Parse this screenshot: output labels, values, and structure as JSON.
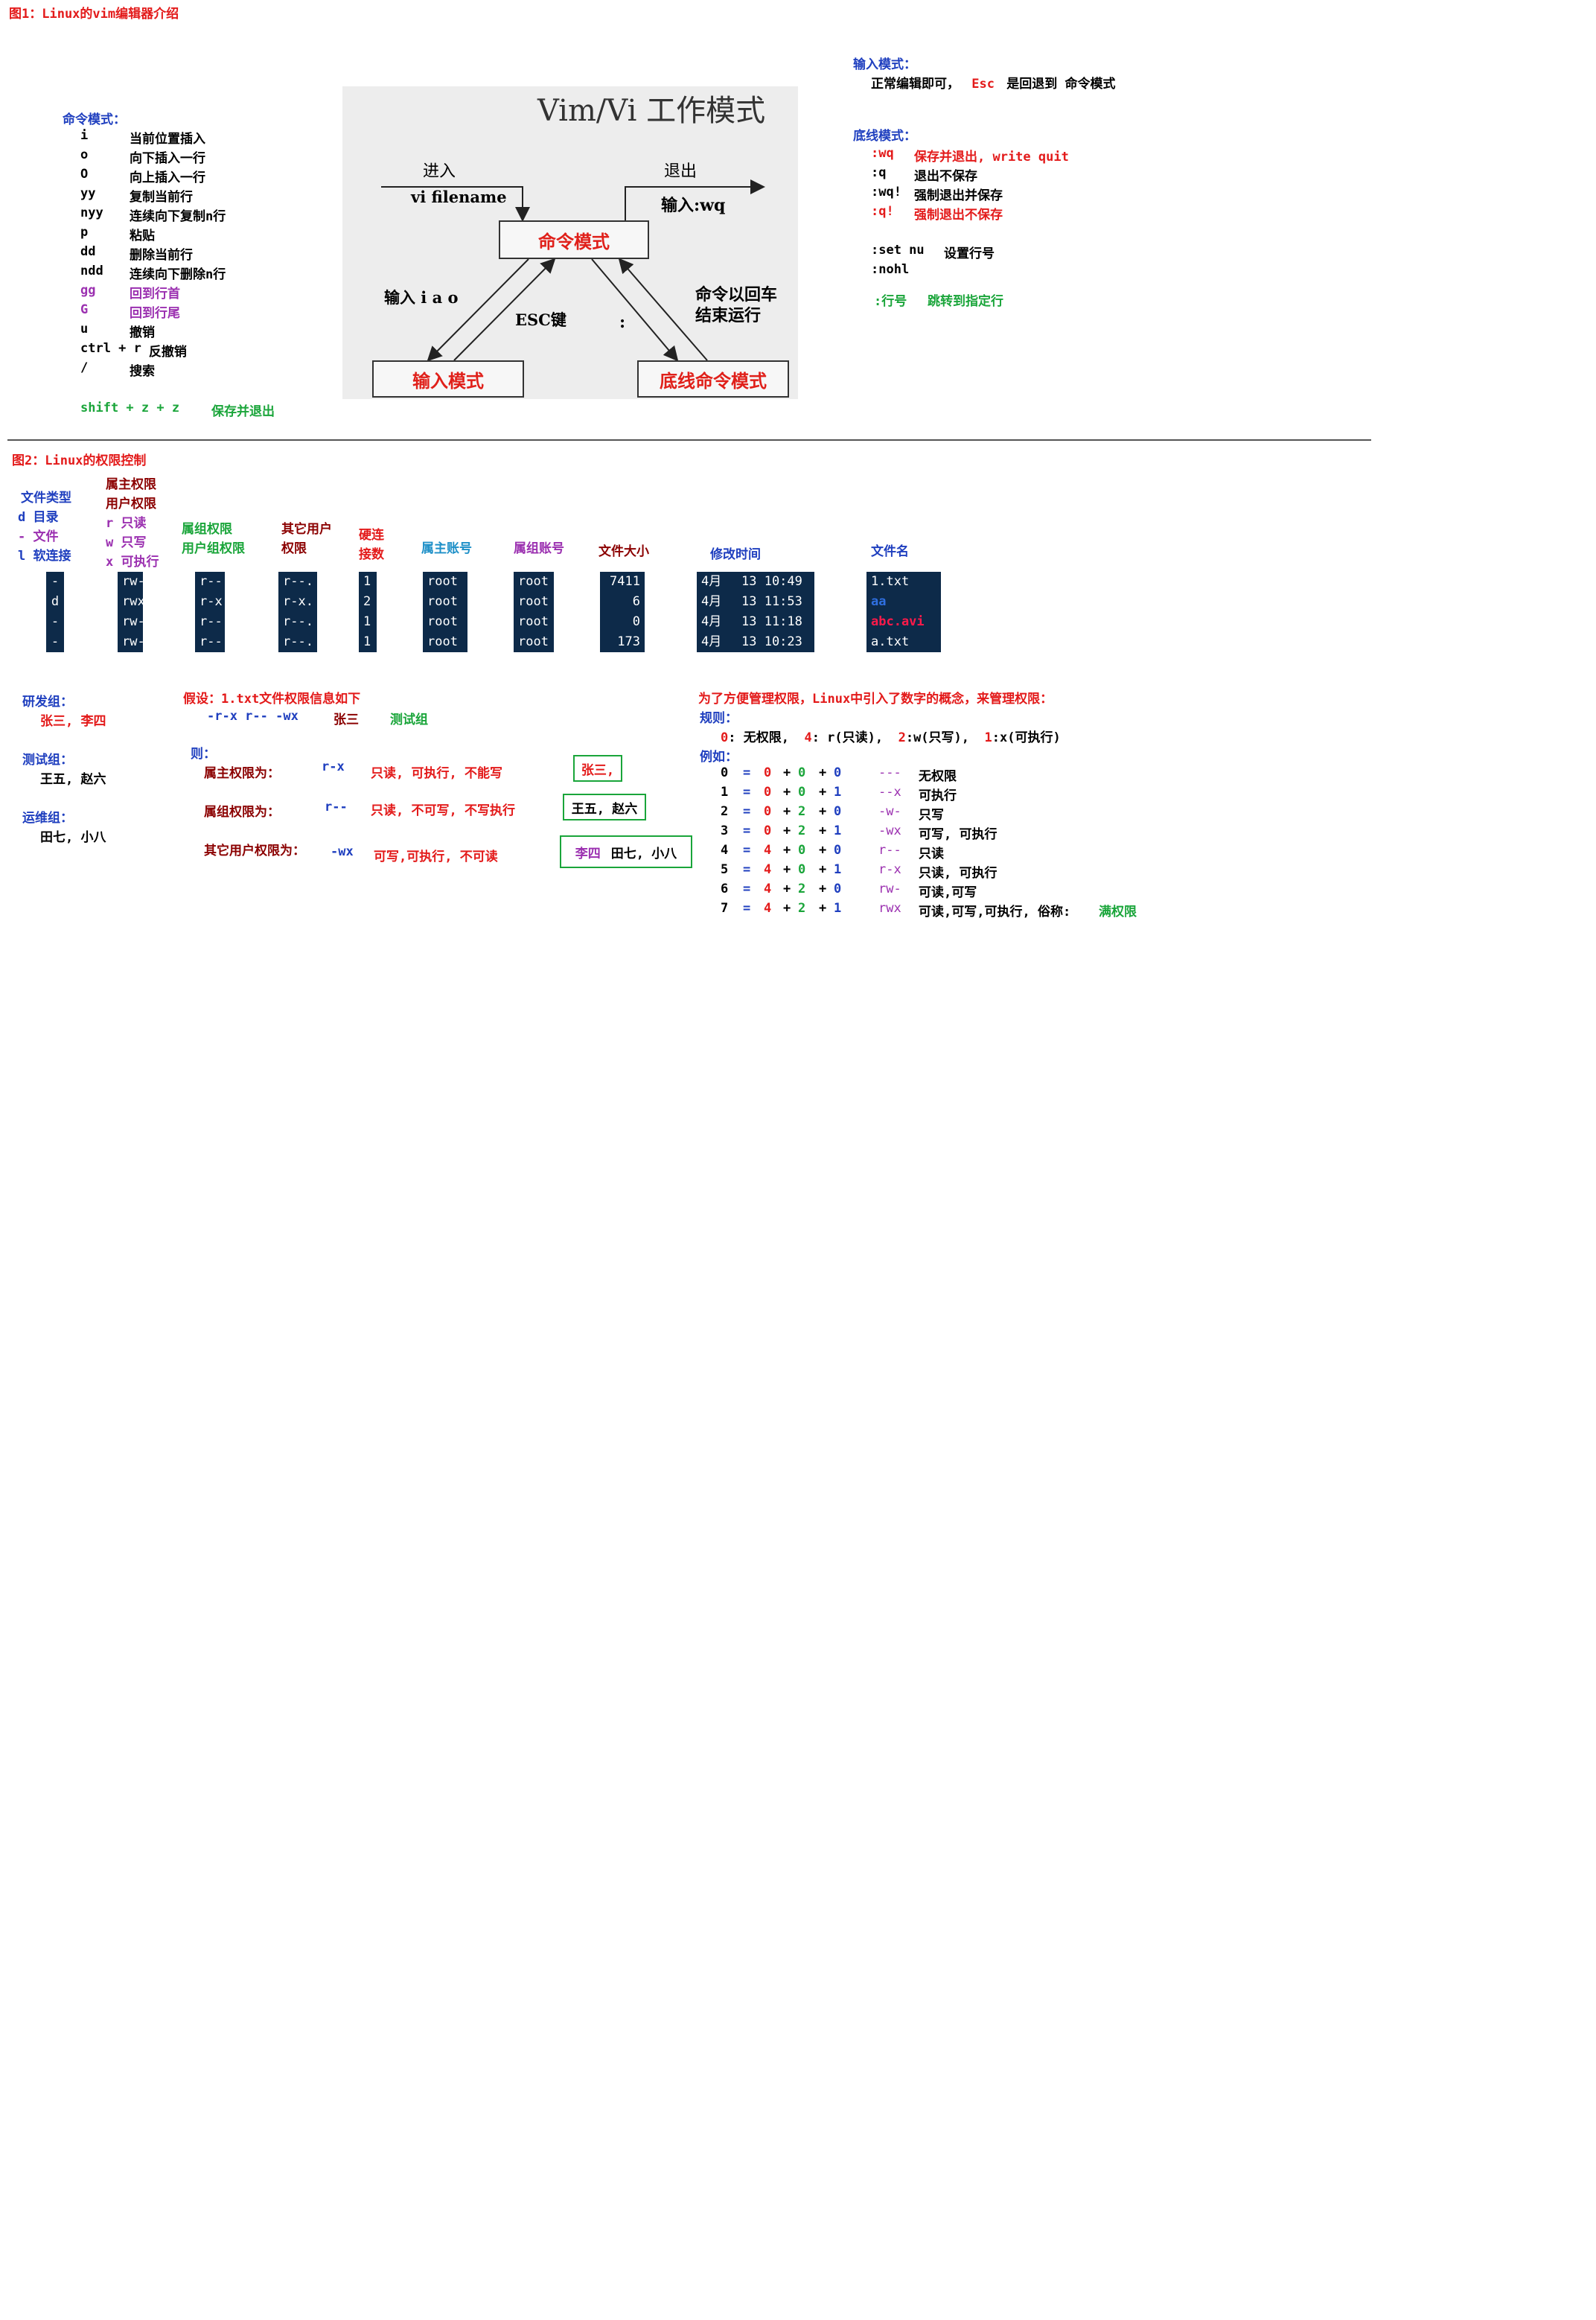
{
  "fig1": {
    "title": "图1：Linux的vim编辑器介绍",
    "command_mode": {
      "heading": "命令模式：",
      "items": [
        {
          "key": "i",
          "desc": "当前位置插入"
        },
        {
          "key": "o",
          "desc": "向下插入一行"
        },
        {
          "key": "O",
          "desc": "向上插入一行"
        },
        {
          "key": "yy",
          "desc": "复制当前行"
        },
        {
          "key": "nyy",
          "desc": "连续向下复制n行"
        },
        {
          "key": "p",
          "desc": "粘贴"
        },
        {
          "key": "dd",
          "desc": "删除当前行"
        },
        {
          "key": "ndd",
          "desc": "连续向下删除n行"
        },
        {
          "key": "gg",
          "desc": "回到行首"
        },
        {
          "key": "G",
          "desc": "回到行尾"
        },
        {
          "key": "u",
          "desc": "撤销"
        },
        {
          "key": "ctrl + r",
          "desc": "反撤销"
        },
        {
          "key": "/",
          "desc": "搜索"
        }
      ],
      "shift_zz": "shift + z + z",
      "shift_zz_desc": "保存并退出"
    },
    "diagram": {
      "title": "Vim/Vi 工作模式",
      "enter": "进入",
      "vi_filename": "vi filename",
      "exit": "退出",
      "input_wq": "输入:wq",
      "command_mode": "命令模式",
      "input_iao": "输入 i a o",
      "esc": "ESC键",
      "colon": ":",
      "enter_run_1": "命令以回车",
      "enter_run_2": "结束运行",
      "insert_mode": "输入模式",
      "lastline_mode": "底线命令模式"
    },
    "input_mode": {
      "heading": "输入模式：",
      "desc_pre": "正常编辑即可，",
      "esc": "Esc",
      "desc_post": "是回退到 命令模式"
    },
    "lastline_mode": {
      "heading": "底线模式：",
      "wq_key": ":wq",
      "wq_desc": "保存并退出, write quit",
      "q_key": ":q",
      "q_desc": "退出不保存",
      "wqf_key": ":wq!",
      "wqf_desc": "强制退出并保存",
      "qf_key": ":q!",
      "qf_desc": "强制退出不保存",
      "setnu_key": ":set nu",
      "setnu_desc": "设置行号",
      "nohl": ":nohl",
      "jump_key": ":行号",
      "jump_desc": "跳转到指定行"
    }
  },
  "fig2": {
    "title": "图2：Linux的权限控制",
    "headers": {
      "file_type": "文件类型",
      "type_d": "d 目录",
      "type_f": "- 文件",
      "type_l": "l 软连接",
      "owner_perm_1": "属主权限",
      "owner_perm_2": "用户权限",
      "r_read": "r 只读",
      "w_write": "w 只写",
      "x_exec": "x 可执行",
      "group_perm_1": "属组权限",
      "group_perm_2": "用户组权限",
      "other_perm_1": "其它用户",
      "other_perm_2": "权限",
      "hardlink_1": "硬连",
      "hardlink_2": "接数",
      "owner_acct": "属主账号",
      "group_acct": "属组账号",
      "size": "文件大小",
      "mtime": "修改时间",
      "filename": "文件名"
    },
    "rows": [
      {
        "type": "-",
        "owner": "rw-",
        "group": "r--",
        "other": "r--.",
        "links": "1",
        "user": "root",
        "grp": "root",
        "size": "7411",
        "month": "4月",
        "time": "13 10:49",
        "name": "1.txt",
        "name_color": "#ffffff"
      },
      {
        "type": "d",
        "owner": "rwx",
        "group": "r-x",
        "other": "r-x.",
        "links": "2",
        "user": "root",
        "grp": "root",
        "size": "6",
        "month": "4月",
        "time": "13 11:53",
        "name": "aa",
        "name_color": "#2f6fe0"
      },
      {
        "type": "-",
        "owner": "rw-",
        "group": "r--",
        "other": "r--.",
        "links": "1",
        "user": "root",
        "grp": "root",
        "size": "0",
        "month": "4月",
        "time": "13 11:18",
        "name": "abc.avi",
        "name_color": "#ff1a4a"
      },
      {
        "type": "-",
        "owner": "rw-",
        "group": "r--",
        "other": "r--.",
        "links": "1",
        "user": "root",
        "grp": "root",
        "size": "173",
        "month": "4月",
        "time": "13 10:23",
        "name": "a.txt",
        "name_color": "#ffffff"
      }
    ],
    "groups": {
      "dev_label": "研发组：",
      "dev_members": "张三, 李四",
      "test_label": "测试组：",
      "test_members": "王五, 赵六",
      "ops_label": "运维组：",
      "ops_members": "田七, 小八"
    },
    "example": {
      "assume": "假设：1.txt文件权限信息如下",
      "perm_str": "-r-x r-- -wx",
      "owner_name": "张三",
      "group_name": "测试组",
      "then": "则：",
      "owner_label": "属主权限为：",
      "owner_perm": "r-x",
      "owner_desc": "只读, 可执行, 不能写",
      "owner_box": "张三,",
      "group_label": "属组权限为：",
      "group_perm": "r--",
      "group_desc": "只读, 不可写, 不写执行",
      "group_box": "王五, 赵六",
      "other_label": "其它用户权限为：",
      "other_perm": "-wx",
      "other_desc": "可写,可执行, 不可读",
      "other_box_a": "李四",
      "other_box_b": "田七, 小八"
    },
    "numeric": {
      "intro": "为了方便管理权限，Linux中引入了数字的概念，来管理权限：",
      "rule_label": "规则：",
      "rule_line": [
        {
          "n": "0",
          "t": ": 无权限,  "
        },
        {
          "n": "4",
          "t": ": r(只读),  "
        },
        {
          "n": "2",
          "t": ":w(只写),  "
        },
        {
          "n": "1",
          "t": ":x(可执行)"
        }
      ],
      "example_label": "例如：",
      "rows": [
        {
          "v": "0",
          "a": "0",
          "b": "0",
          "c": "0",
          "perm": "---",
          "desc": "无权限"
        },
        {
          "v": "1",
          "a": "0",
          "b": "0",
          "c": "1",
          "perm": "--x",
          "desc": "可执行"
        },
        {
          "v": "2",
          "a": "0",
          "b": "2",
          "c": "0",
          "perm": "-w-",
          "desc": "只写"
        },
        {
          "v": "3",
          "a": "0",
          "b": "2",
          "c": "1",
          "perm": "-wx",
          "desc": "可写, 可执行"
        },
        {
          "v": "4",
          "a": "4",
          "b": "0",
          "c": "0",
          "perm": "r--",
          "desc": "只读"
        },
        {
          "v": "5",
          "a": "4",
          "b": "0",
          "c": "1",
          "perm": "r-x",
          "desc": "只读, 可执行"
        },
        {
          "v": "6",
          "a": "4",
          "b": "2",
          "c": "0",
          "perm": "rw-",
          "desc": "可读,可写"
        },
        {
          "v": "7",
          "a": "4",
          "b": "2",
          "c": "1",
          "perm": "rwx",
          "desc": "可读,可写,可执行, 俗称:"
        }
      ],
      "full_perm": "满权限"
    }
  }
}
